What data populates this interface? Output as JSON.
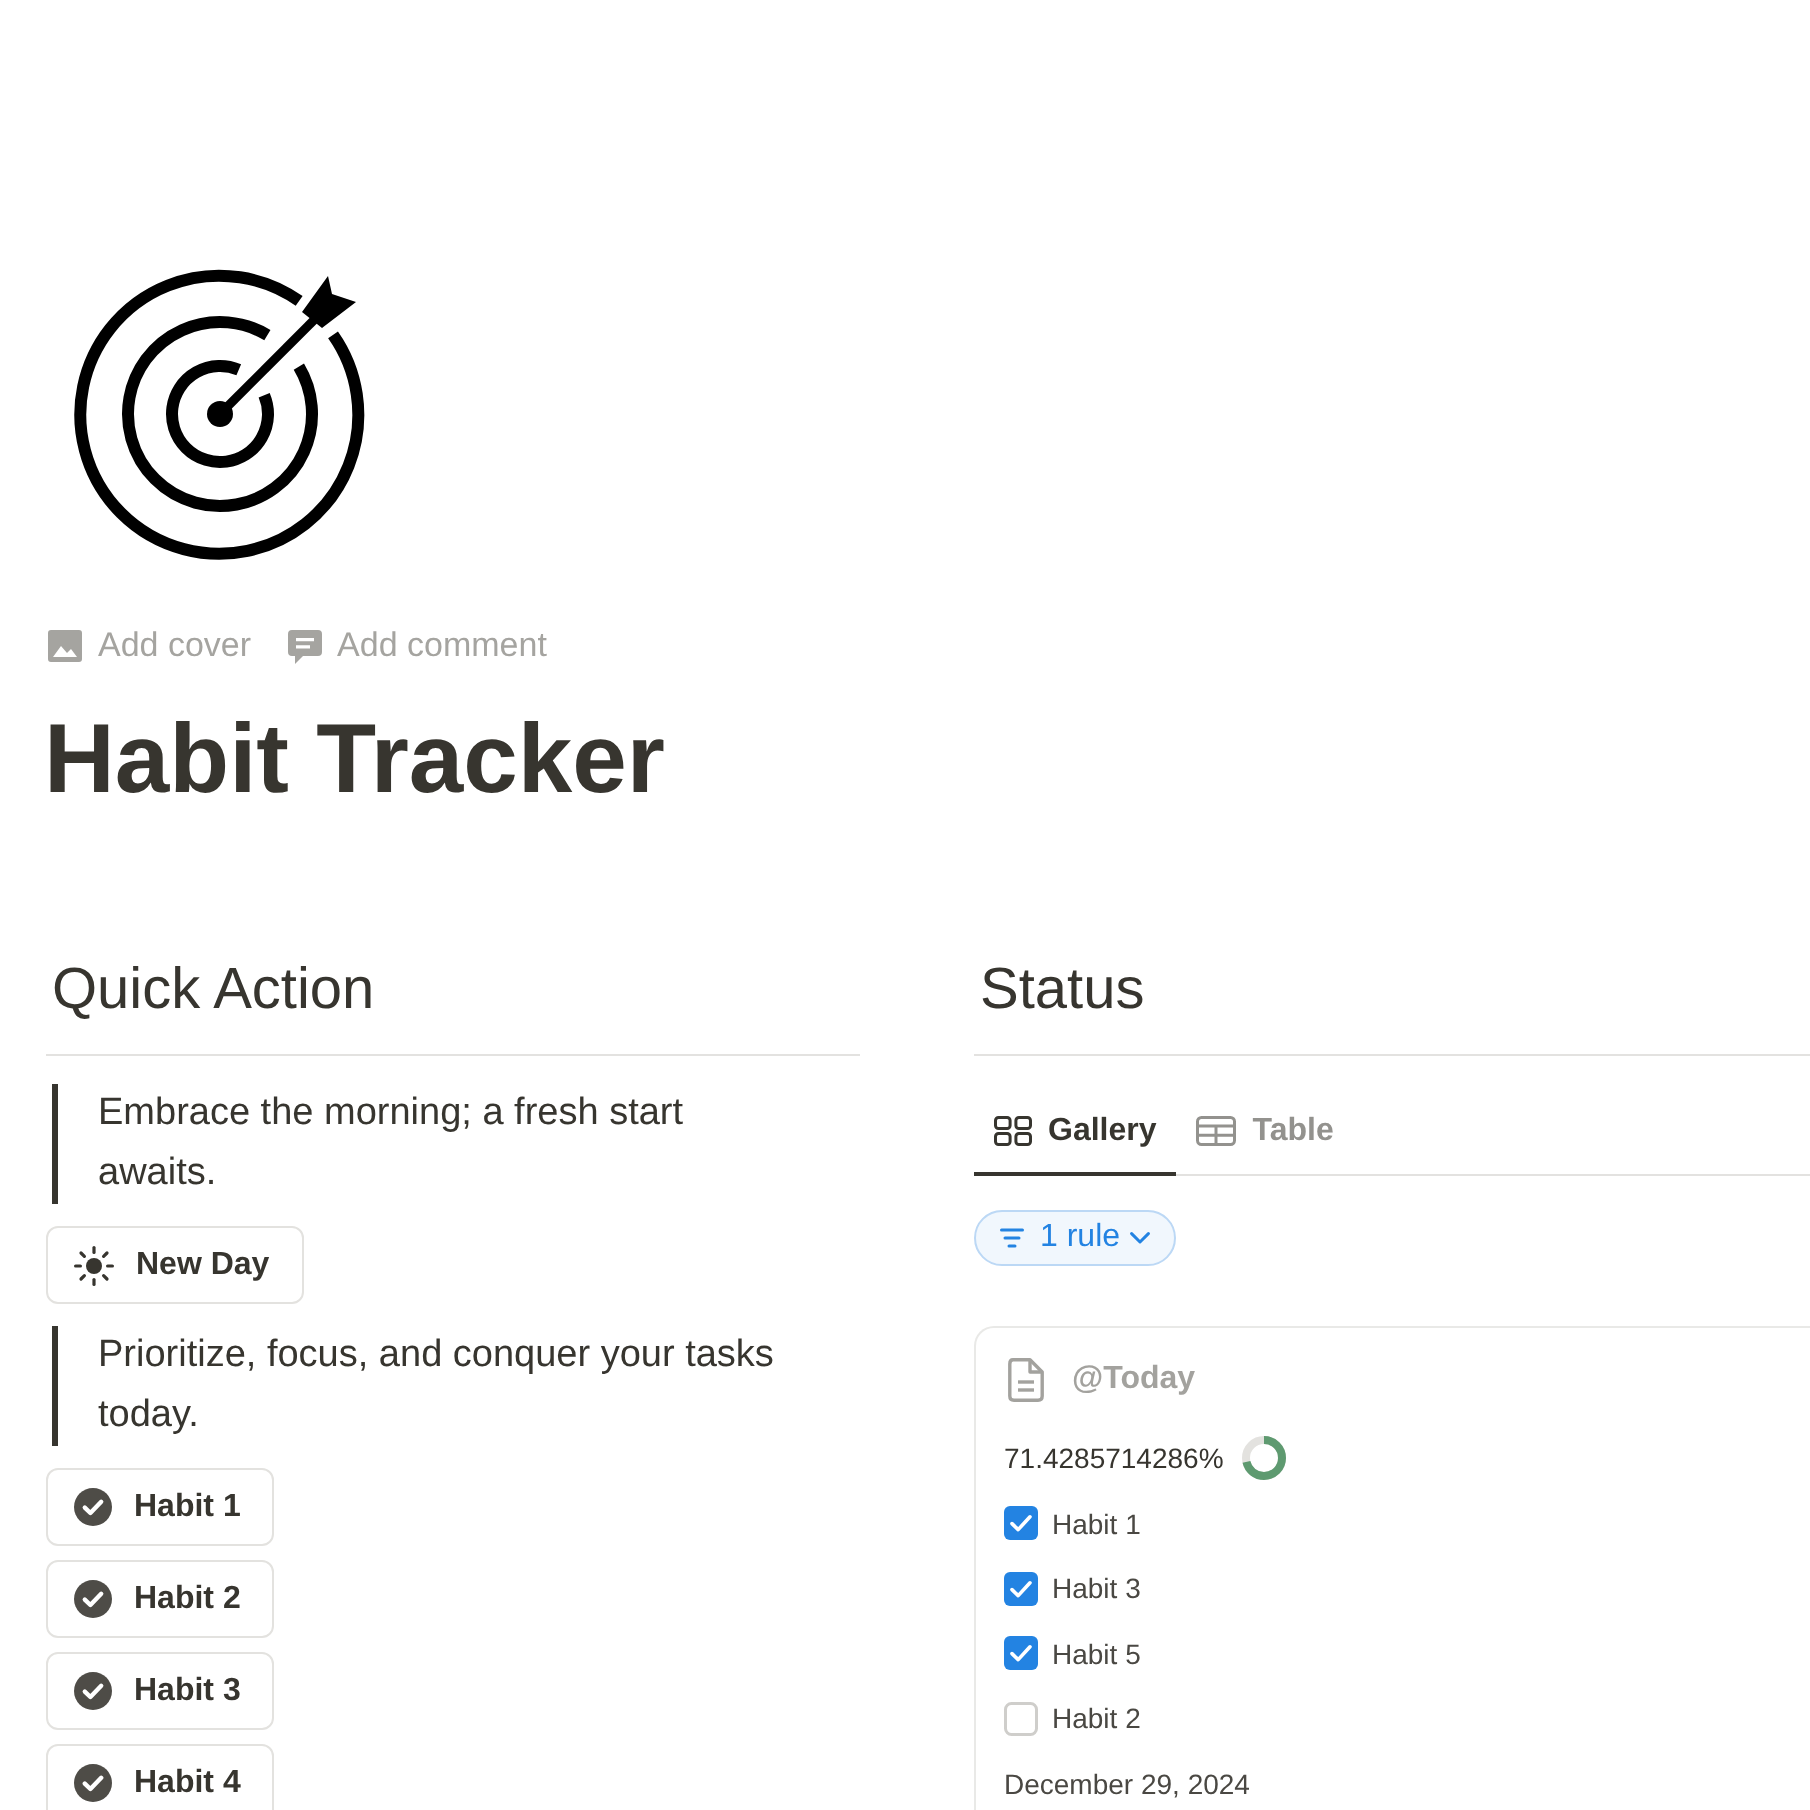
{
  "page_actions": [
    {
      "kind": "cover",
      "label": "Add cover"
    },
    {
      "kind": "comment",
      "label": "Add comment"
    }
  ],
  "title": "Habit Tracker",
  "quick_action": {
    "heading": "Quick Action",
    "blocks": [
      {
        "kind": "quote",
        "text": "Embrace the morning; a fresh start awaits."
      },
      {
        "kind": "action",
        "label": "New Day"
      },
      {
        "kind": "quote",
        "text": "Prioritize, focus, and conquer your tasks today."
      },
      {
        "kind": "habit",
        "label": "Habit 1"
      },
      {
        "kind": "habit",
        "label": "Habit 2"
      },
      {
        "kind": "habit",
        "label": "Habit 3"
      },
      {
        "kind": "habit",
        "label": "Habit 4"
      }
    ]
  },
  "status": {
    "heading": "Status",
    "tabs": [
      {
        "kind": "gallery",
        "label": "Gallery",
        "selected": true
      },
      {
        "kind": "table",
        "label": "Table",
        "selected": false
      }
    ],
    "filter": {
      "label": "1 rule"
    },
    "cards": [
      {
        "title": "@Today",
        "progress": {
          "reading": "71.4285714286%",
          "level": 0.714285714286
        },
        "habits": [
          {
            "label": "Habit 1",
            "checked": true
          },
          {
            "label": "Habit 3",
            "checked": true
          },
          {
            "label": "Habit 5",
            "checked": true
          },
          {
            "label": "Habit 2",
            "checked": false
          }
        ],
        "date": "December 29, 2024"
      }
    ]
  }
}
